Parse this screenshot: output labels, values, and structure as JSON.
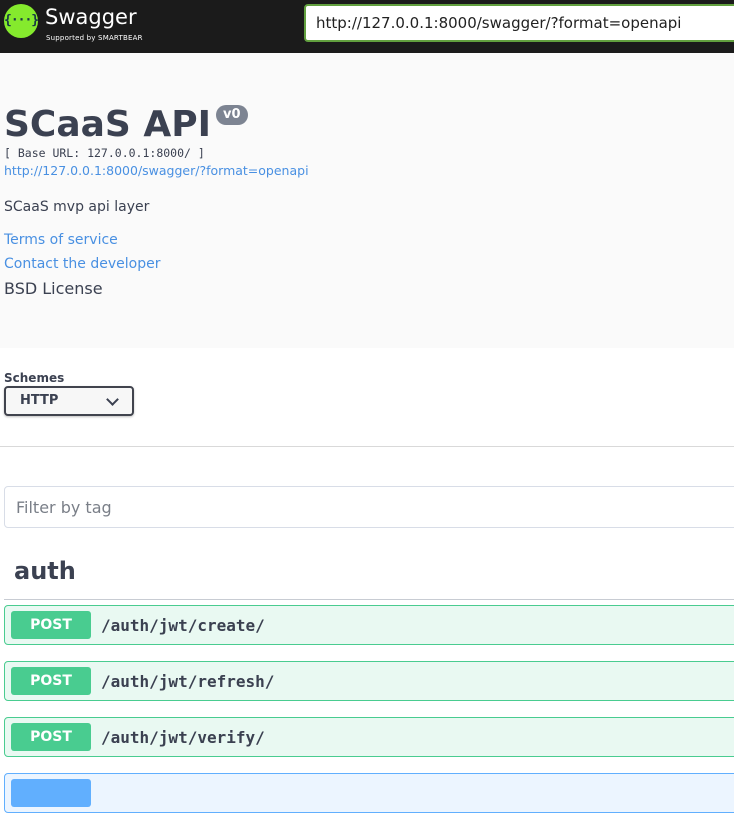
{
  "topbar": {
    "logo_text": "Swagger",
    "logo_sub": "Supported by SMARTBEAR",
    "logo_glyph": "{···}",
    "url_value": "http://127.0.0.1:8000/swagger/?format=openapi"
  },
  "info": {
    "title": "SCaaS API",
    "version": "v0",
    "base_url": "[ Base URL: 127.0.0.1:8000/ ]",
    "spec_link": "http://127.0.0.1:8000/swagger/?format=openapi",
    "description": "SCaaS mvp api layer",
    "terms": "Terms of service",
    "contact": "Contact the developer",
    "license": "BSD License"
  },
  "schemes": {
    "label": "Schemes",
    "selected": "HTTP"
  },
  "filter": {
    "placeholder": "Filter by tag"
  },
  "tag": {
    "name": "auth"
  },
  "operations": [
    {
      "method": "POST",
      "path": "/auth/jwt/create/"
    },
    {
      "method": "POST",
      "path": "/auth/jwt/refresh/"
    },
    {
      "method": "POST",
      "path": "/auth/jwt/verify/"
    }
  ],
  "colors": {
    "post": "#49cc90",
    "get": "#61affe",
    "brand": "#85ea2d",
    "link": "#4990e2"
  }
}
